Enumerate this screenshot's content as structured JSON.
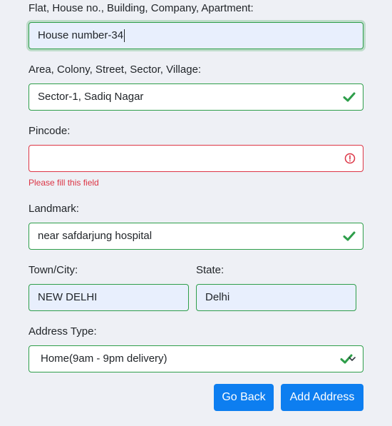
{
  "address_form": {
    "flat": {
      "label": "Flat, House no., Building, Company, Apartment:",
      "value": "House number-34"
    },
    "area": {
      "label": "Area, Colony, Street, Sector, Village:",
      "value": "Sector-1, Sadiq Nagar"
    },
    "pincode": {
      "label": "Pincode:",
      "value": "",
      "error": "Please fill this field"
    },
    "landmark": {
      "label": "Landmark:",
      "value": "near safdarjung hospital"
    },
    "city": {
      "label": "Town/City:",
      "value": "NEW DELHI"
    },
    "state": {
      "label": "State:",
      "value": "Delhi"
    },
    "address_type": {
      "label": "Address Type:",
      "selected": "Home(9am - 9pm delivery)"
    },
    "buttons": {
      "back": "Go Back",
      "add": "Add Address"
    }
  },
  "colors": {
    "valid": "#2e9e4a",
    "invalid": "#dc3545",
    "primary": "#0d7ef0",
    "autofill": "#e8effd",
    "background": "#eef0f5"
  },
  "icons": {
    "valid": "check-icon",
    "invalid": "alert-circle-icon",
    "select": "chevron-down-icon"
  }
}
